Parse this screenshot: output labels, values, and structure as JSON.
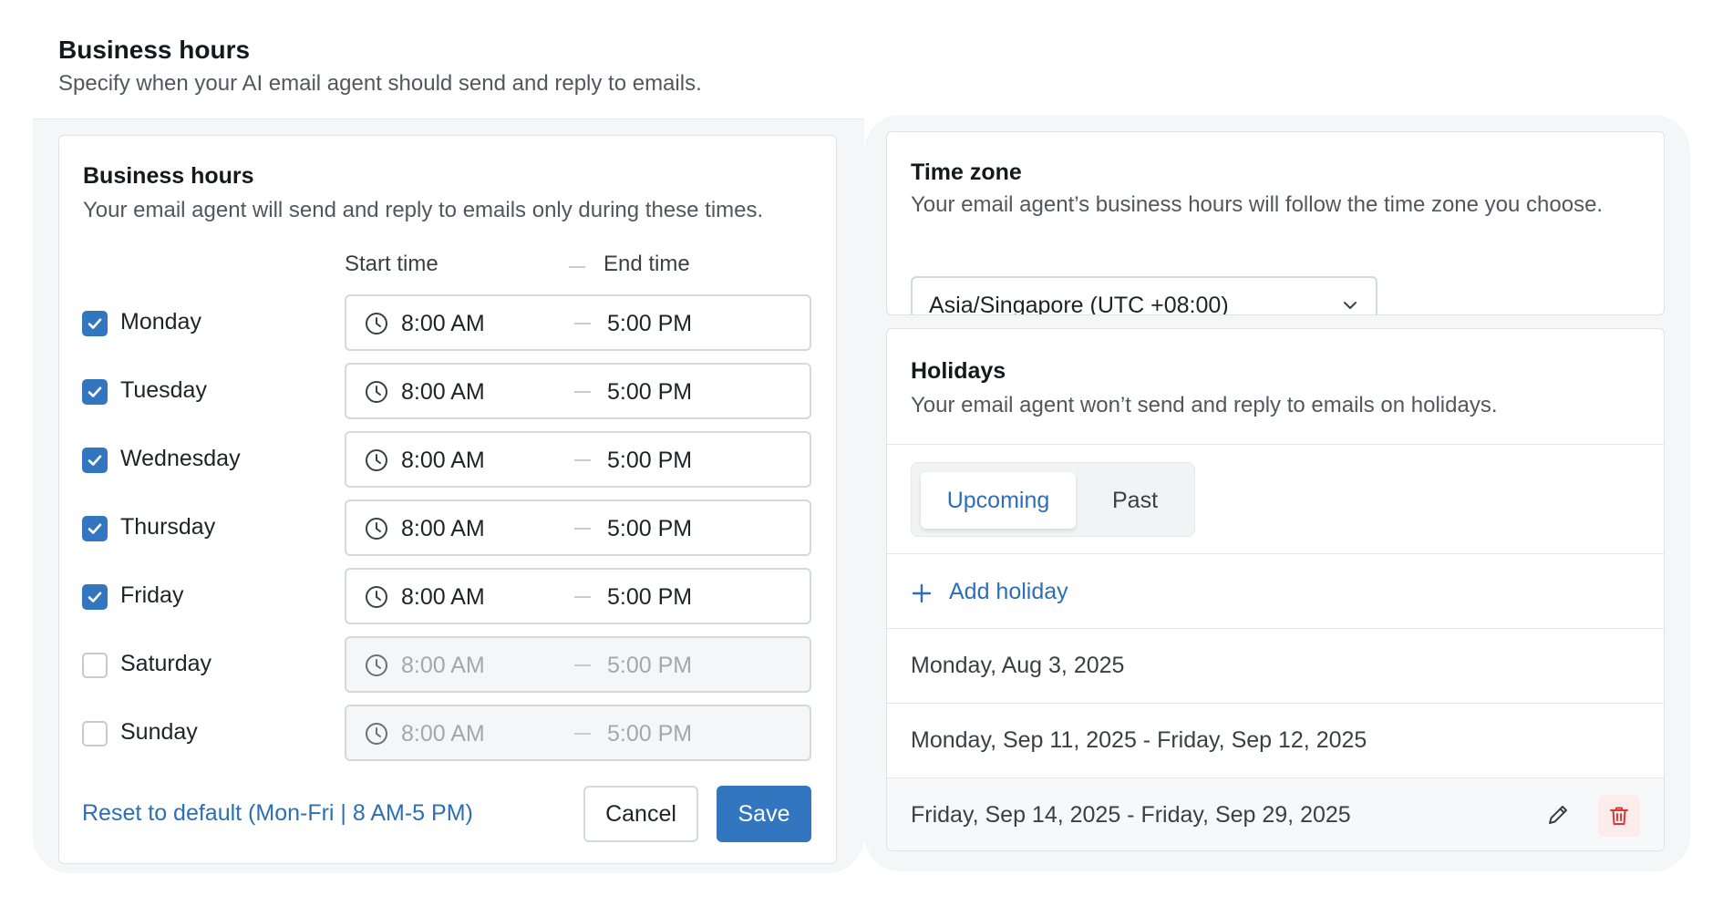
{
  "page": {
    "title": "Business hours",
    "subtitle": "Specify when your AI email agent should send and reply to emails."
  },
  "business_hours": {
    "title": "Business hours",
    "description": "Your email agent will send and reply to emails only during these times.",
    "start_header": "Start time",
    "end_header": "End time",
    "days": [
      {
        "label": "Monday",
        "checked": true,
        "start": "8:00 AM",
        "end": "5:00 PM"
      },
      {
        "label": "Tuesday",
        "checked": true,
        "start": "8:00 AM",
        "end": "5:00 PM"
      },
      {
        "label": "Wednesday",
        "checked": true,
        "start": "8:00 AM",
        "end": "5:00 PM"
      },
      {
        "label": "Thursday",
        "checked": true,
        "start": "8:00 AM",
        "end": "5:00 PM"
      },
      {
        "label": "Friday",
        "checked": true,
        "start": "8:00 AM",
        "end": "5:00 PM"
      },
      {
        "label": "Saturday",
        "checked": false,
        "start": "8:00 AM",
        "end": "5:00 PM"
      },
      {
        "label": "Sunday",
        "checked": false,
        "start": "8:00 AM",
        "end": "5:00 PM"
      }
    ],
    "reset_label": "Reset to default (Mon-Fri | 8 AM-5 PM)",
    "cancel_label": "Cancel",
    "save_label": "Save"
  },
  "time_zone": {
    "title": "Time zone",
    "description": "Your email agent’s business hours will follow the time zone you choose.",
    "selected": "Asia/Singapore (UTC +08:00)"
  },
  "holidays": {
    "title": "Holidays",
    "description": "Your email agent won’t send and reply to emails on holidays.",
    "tabs": [
      "Upcoming",
      "Past"
    ],
    "active_tab": "Upcoming",
    "add_label": "Add holiday",
    "items": [
      "Monday, Aug 3, 2025",
      "Monday, Sep 11, 2025 - Friday, Sep 12, 2025",
      "Friday, Sep 14, 2025 - Friday, Sep 29, 2025"
    ]
  },
  "colors": {
    "accent": "#3276c0",
    "link": "#2c6fb7",
    "danger": "#d93a3a",
    "danger_bg": "#fdecec"
  },
  "icons": [
    "clock-icon",
    "checkmark-icon",
    "chevron-down-icon",
    "plus-icon",
    "pencil-icon",
    "trash-icon"
  ]
}
